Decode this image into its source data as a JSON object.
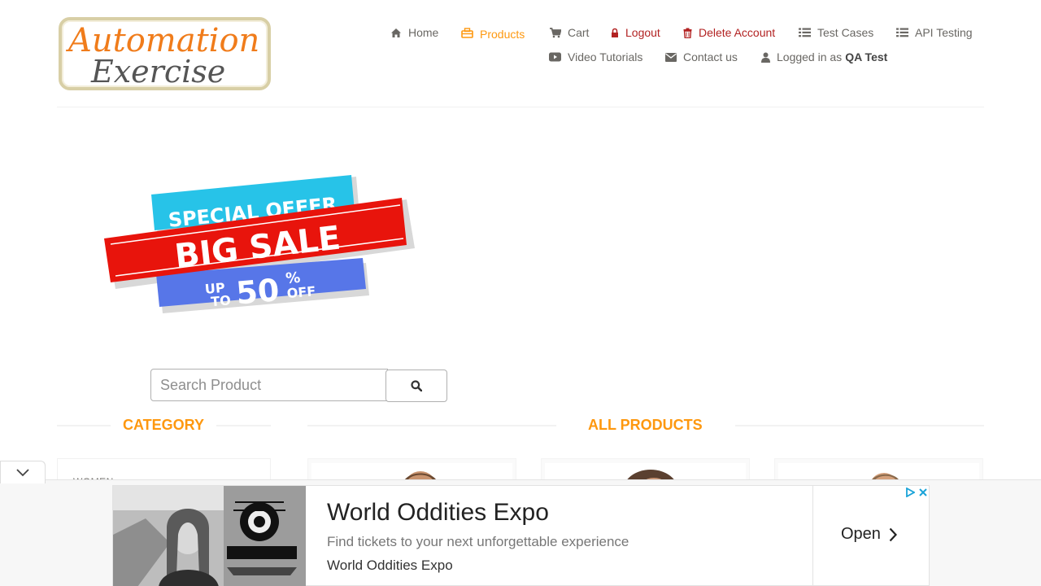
{
  "logo": {
    "line1": "Automation",
    "line2": "Exercise"
  },
  "nav": {
    "home": "Home",
    "products": "Products",
    "cart": "Cart",
    "logout": "Logout",
    "delete_account": "Delete Account",
    "test_cases": "Test Cases",
    "api_testing": "API Testing",
    "video_tutorials": "Video Tutorials",
    "contact_us": "Contact us",
    "logged_in_prefix": "Logged in as",
    "logged_in_user": "QA Test"
  },
  "banner": {
    "top": "SPECIAL OFFER",
    "middle": "BIG SALE",
    "up": "UP",
    "to": "TO",
    "amount": "50",
    "percent": "%",
    "off": "OFF"
  },
  "search": {
    "placeholder": "Search Product",
    "value": ""
  },
  "sections": {
    "category": "CATEGORY",
    "all_products": "ALL PRODUCTS"
  },
  "category": {
    "first_item": "WOMEN",
    "expand_symbol": "+"
  },
  "ad": {
    "title": "World Oddities Expo",
    "description": "Find tickets to your next unforgettable experience",
    "advertiser": "World Oddities Expo",
    "cta": "Open"
  },
  "colors": {
    "accent": "#fe980f",
    "danger": "#b22222",
    "text": "#696763"
  },
  "icons": {
    "home": "home-icon",
    "products": "products-icon",
    "cart": "cart-icon",
    "logout": "lock-icon",
    "delete": "trash-icon",
    "test_cases": "list-icon",
    "api": "list-icon",
    "video": "youtube-icon",
    "contact": "envelope-icon",
    "user": "user-icon",
    "search": "search-icon"
  }
}
